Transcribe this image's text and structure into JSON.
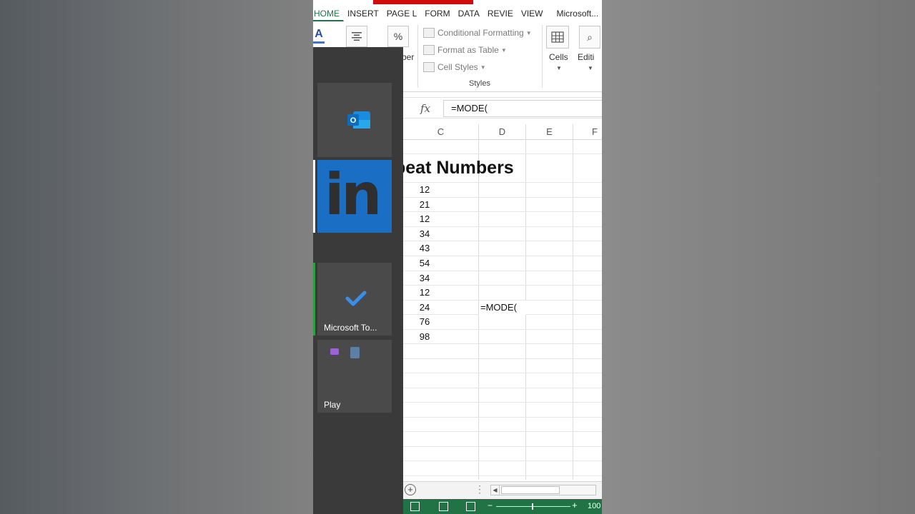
{
  "ribbon": {
    "tabs": [
      "HOME",
      "INSERT",
      "PAGE L",
      "FORM",
      "DATA",
      "REVIE",
      "VIEW",
      "Microsoft..."
    ],
    "font_icon": "A",
    "align_icon": "align-center-icon",
    "percent_icon": "%",
    "number_label": "ber",
    "styles": {
      "conditional_formatting": "Conditional Formatting",
      "format_as_table": "Format as Table",
      "cell_styles": "Cell Styles",
      "group_label": "Styles"
    },
    "cells_label": "Cells",
    "editing_label": "Editi"
  },
  "formula_bar": {
    "fx": "fx",
    "value": "=MODE("
  },
  "sheet": {
    "columns": [
      "C",
      "D",
      "E",
      "F"
    ],
    "title": "peat Numbers",
    "column_c_values": [
      "12",
      "21",
      "12",
      "34",
      "43",
      "54",
      "34",
      "12",
      "24",
      "76",
      "98"
    ],
    "d_formula": "=MODE("
  },
  "status_bar": {
    "zoom": "100"
  },
  "switcher": {
    "todo_label": "Microsoft To...",
    "play_label": "Play",
    "linkedin_text": "in"
  },
  "colors": {
    "excel_green": "#217346",
    "linkedin_blue": "#1a6fc4",
    "switcher_bg": "#3a3a3a",
    "youtube_red": "#d10a0a"
  }
}
